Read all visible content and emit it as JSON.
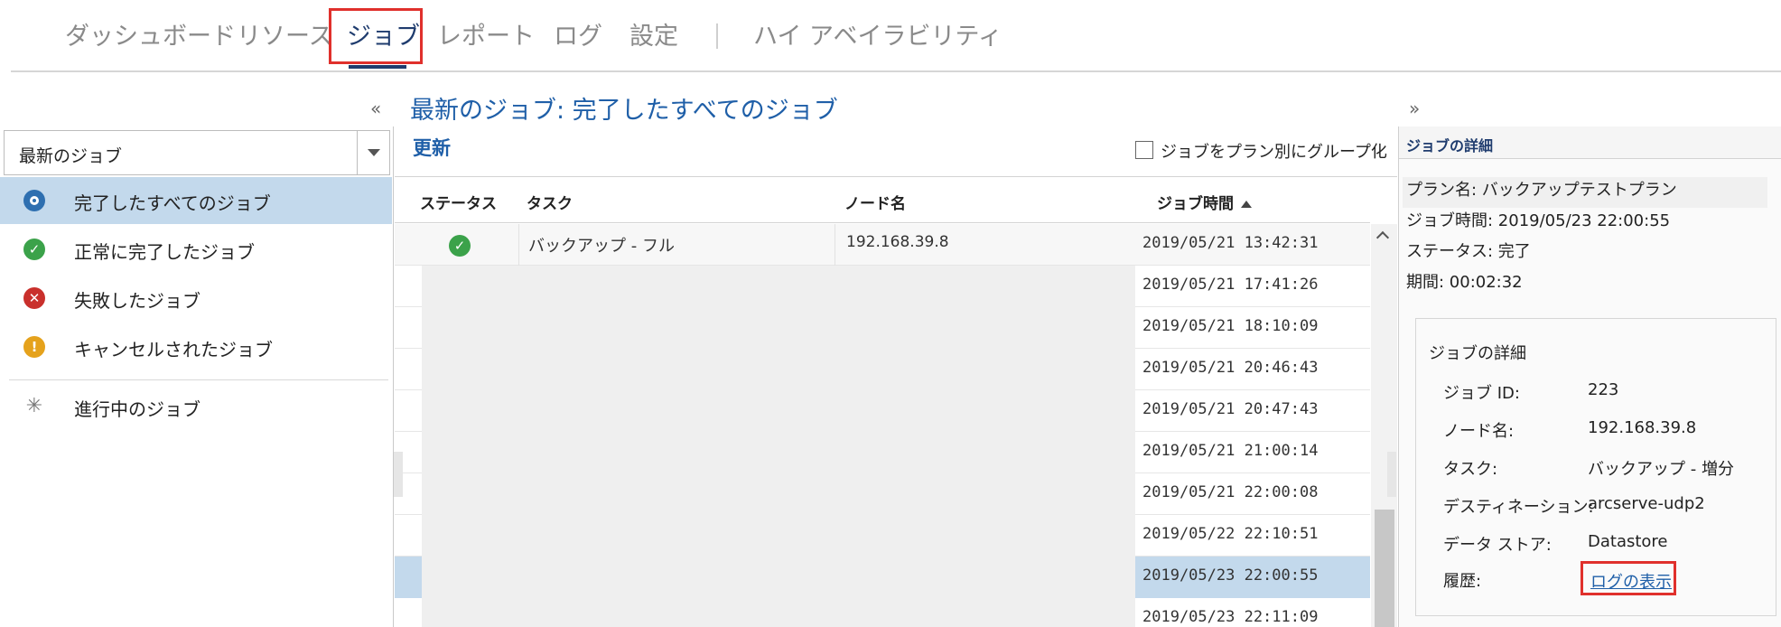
{
  "nav": {
    "tabs": [
      {
        "label": "ダッシュボード"
      },
      {
        "label": "リソース"
      },
      {
        "label": "ジョブ"
      },
      {
        "label": "レポート"
      },
      {
        "label": "ログ"
      },
      {
        "label": "設定"
      },
      {
        "label": "ハイ アベイラビリティ"
      }
    ],
    "active_tab": "ジョブ"
  },
  "page_title": "最新のジョブ: 完了したすべてのジョブ",
  "left_panel": {
    "select_value": "最新のジョブ",
    "filters": [
      {
        "label": "完了したすべてのジョブ",
        "icon": "all-jobs-icon",
        "selected": true
      },
      {
        "label": "正常に完了したジョブ",
        "icon": "success-icon"
      },
      {
        "label": "失敗したジョブ",
        "icon": "failed-icon"
      },
      {
        "label": "キャンセルされたジョブ",
        "icon": "warning-icon"
      },
      {
        "label": "進行中のジョブ",
        "icon": "spinner-icon"
      }
    ]
  },
  "toolbar": {
    "refresh_label": "更新",
    "group_by_plan_label": "ジョブをプラン別にグループ化",
    "group_by_plan_checked": false
  },
  "grid": {
    "columns": {
      "status": "ステータス",
      "task": "タスク",
      "node": "ノード名",
      "job_time": "ジョブ時間"
    },
    "sort": "job_time ascending",
    "rows": [
      {
        "status": "success",
        "task": "バックアップ - フル",
        "node": "192.168.39.8",
        "job_time": "2019/05/21 13:42:31"
      },
      {
        "job_time": "2019/05/21 17:41:26"
      },
      {
        "job_time": "2019/05/21 18:10:09"
      },
      {
        "job_time": "2019/05/21 20:46:43"
      },
      {
        "job_time": "2019/05/21 20:47:43"
      },
      {
        "job_time": "2019/05/21 21:00:14"
      },
      {
        "job_time": "2019/05/21 22:00:08"
      },
      {
        "job_time": "2019/05/22 22:10:51"
      },
      {
        "job_time": "2019/05/23 22:00:55",
        "selected": true
      },
      {
        "job_time": "2019/05/23 22:11:09"
      }
    ]
  },
  "details": {
    "header": "ジョブの詳細",
    "summary": {
      "plan": "プラン名: バックアップテストプラン",
      "job_time": "ジョブ時間: 2019/05/23 22:00:55",
      "status": "ステータス: 完了",
      "duration": "期間: 00:02:32"
    },
    "box_title": "ジョブの詳細",
    "rows": [
      {
        "key": "ジョブ ID:",
        "value": "223"
      },
      {
        "key": "ノード名:",
        "value": "192.168.39.8"
      },
      {
        "key": "タスク:",
        "value": "バックアップ - 増分"
      },
      {
        "key": "デスティネーション:",
        "value": "arcserve-udp2"
      },
      {
        "key": "データ ストア:",
        "value": "Datastore"
      }
    ],
    "history_key": "履歴:",
    "history_link": "ログの表示"
  },
  "colors": {
    "accent": "#1f5fa8",
    "selection": "#c3d9ec",
    "highlight_box": "#e0302c",
    "success": "#3ba24a",
    "failed": "#c9302c",
    "warning": "#e5a21c"
  }
}
